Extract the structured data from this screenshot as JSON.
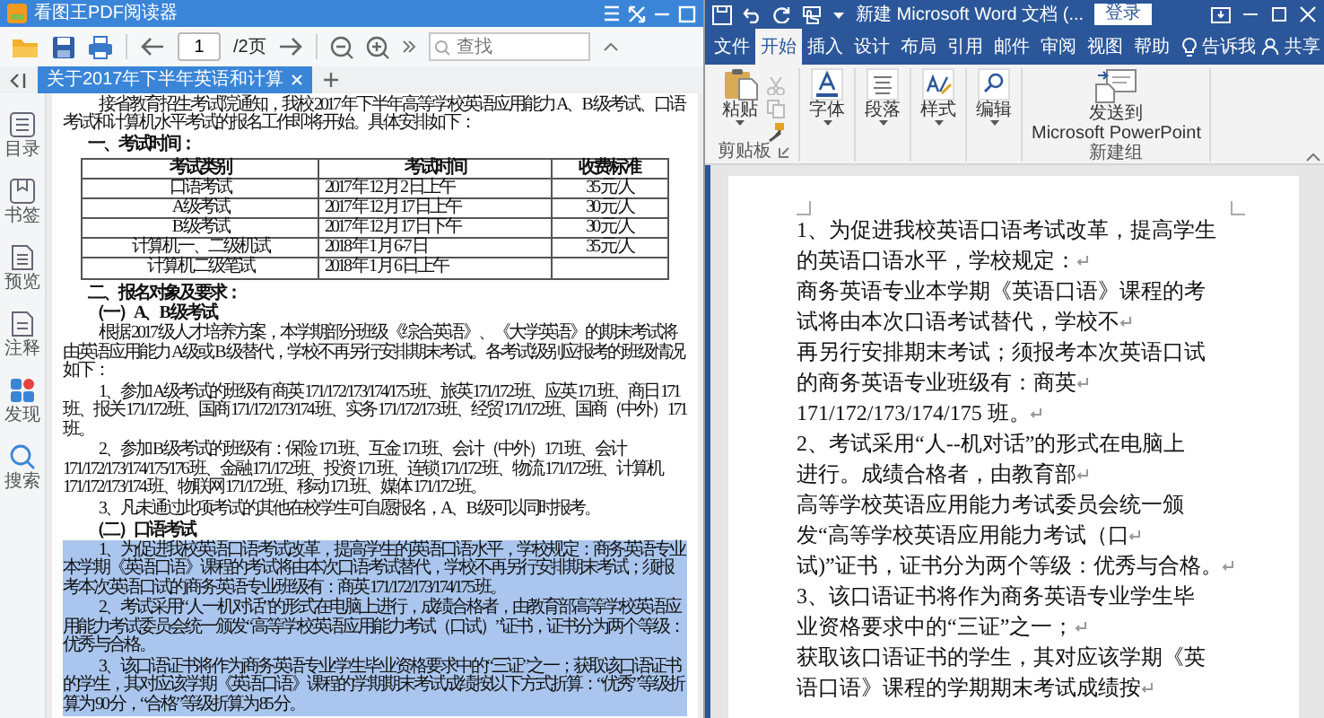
{
  "pdf_reader": {
    "window": {
      "title": "看图王PDF阅读器"
    },
    "toolbar": {
      "page_number": "1",
      "page_total": "/2页",
      "search": {
        "placeholder": "查找"
      }
    },
    "tabs": [
      {
        "label": "关于2017年下半年英语和计算",
        "selected": true
      }
    ],
    "sidebar": {
      "items": [
        {
          "label": "目录",
          "kind": "contents"
        },
        {
          "label": "书签",
          "kind": "bookmark"
        },
        {
          "label": "预览",
          "kind": "preview"
        },
        {
          "label": "注释",
          "kind": "note"
        },
        {
          "label": "发现",
          "kind": "discover"
        },
        {
          "label": "搜索",
          "kind": "search"
        }
      ]
    },
    "document": {
      "blocks": [
        {
          "kind": "paragraph",
          "text": "接省教育招生考试院通知，我校 2017 年下半年高等学校英语应用能力 A、B 级考试、口语考试和计算机水平考试的报名工作即将开始。具体安排如下：",
          "selected": false
        },
        {
          "kind": "heading",
          "text": "一、考试时间："
        },
        {
          "kind": "table",
          "columns": [
            "考试类别",
            "考试时间",
            "收费标准"
          ],
          "rows": [
            [
              "口语考试",
              "2017 年 12 月 2 日上午",
              "35 元/人"
            ],
            [
              "A 级考试",
              "2017 年 12 月 17 日上午",
              "30 元/人"
            ],
            [
              "B 级考试",
              "2017 年 12 月 17 日下午",
              "30 元/人"
            ],
            [
              "计算机一、二级机试",
              "2018 年 1 月 6-7 日",
              "35 元/人"
            ],
            [
              "计算机二级笔试",
              "2018 年 1 月 6 日上午"
            ]
          ]
        },
        {
          "kind": "heading",
          "text": "二、报名对象及要求："
        },
        {
          "kind": "heading",
          "text": "（一）A、B 级考试"
        },
        {
          "kind": "paragraph",
          "text": "根据 2017 级人才培养方案，本学期部分班级《综合英语》、《大学英语》的期末考试将由英语应用能力 A 级或 B 级替代，学校不再另行安排期末考试。各考试级别应报考的班级情况如下：",
          "selected": false
        },
        {
          "kind": "paragraph",
          "text": "1、参加 A 级考试的班级有 商英 171/172/173/174/175 班、旅英 171/172 班、应英 171 班、商日 171 班、报关 171/172/班、国商 171/172/173/174 班、实务 171/172/173 班、经贸 171/172 班、国商（中外）171 班。",
          "selected": false
        },
        {
          "kind": "paragraph",
          "text": "2、参加 B 级考试的班级有：保险 171 班、互金 171 班、会计（中外）171 班、会计 171/172/173/174/175/176 班、金融 171/172 班、投资 171 班、连锁 171/172 班、物流 171/172 班、计算机 171/172/173/174 班、物联网 171/172 班、移动 171 班、媒体 171/172 班。",
          "selected": false
        },
        {
          "kind": "paragraph",
          "text": "3、凡未通过此项考试的其他在校学生可自愿报名，A、B 级可以同时报考。",
          "selected": false
        },
        {
          "kind": "heading",
          "text": "（二）口语考试"
        },
        {
          "kind": "paragraph",
          "text": "1、为促进我校英语口语考试改革，提高学生的英语口语水平，学校规定：商务英语专业本学期《英语口语》课程的考试将由本次口语考试替代，学校不再另行安排期末考试；须报考本次英语口试的商务英语专业班级有：商英 171/172/173/174/175 班。",
          "selected": true
        },
        {
          "kind": "paragraph",
          "text": "2、考试采用“人一机对话”的形式在电脑上进行，成绩合格者，由教育部高等学校英语应用能力考试委员会统一颁发“高等学校英语应用能力考试（口试）”证书，证书分为两个等级：优秀与合格。",
          "selected": true
        },
        {
          "kind": "paragraph",
          "text": "3、该口语证书将作为商务英语专业学生毕业资格要求中的“三证”之一；获取该口语证书的学生，其对应该学期《英语口语》课程的学期期末考试成绩按以下方式折算：“优秀”等级折算为 90 分，“合格”等级折算为 85 分。",
          "selected": true
        }
      ]
    }
  },
  "word": {
    "window": {
      "title": "新建 Microsoft Word 文档 (...",
      "sign_in": "登录"
    },
    "tabs": [
      {
        "label": "文件",
        "selected": false
      },
      {
        "label": "开始",
        "selected": true
      },
      {
        "label": "插入",
        "selected": false
      },
      {
        "label": "设计",
        "selected": false
      },
      {
        "label": "布局",
        "selected": false
      },
      {
        "label": "引用",
        "selected": false
      },
      {
        "label": "邮件",
        "selected": false
      },
      {
        "label": "审阅",
        "selected": false
      },
      {
        "label": "视图",
        "selected": false
      },
      {
        "label": "帮助",
        "selected": false
      }
    ],
    "tell_me": "告诉我",
    "share": "共享",
    "ribbon": {
      "groups": [
        {
          "label": "剪贴板",
          "launcher": true,
          "buttons": [
            {
              "kind": "paste",
              "label_lines": [
                "粘贴"
              ],
              "dropdown": true
            }
          ],
          "tools": [
            {
              "kind": "cut",
              "disabled": true
            },
            {
              "kind": "copy",
              "disabled": true
            },
            {
              "kind": "format_painter",
              "disabled": false
            }
          ]
        },
        {
          "buttons": [
            {
              "kind": "font",
              "label_lines": [
                "字体"
              ],
              "dropdown": true
            }
          ]
        },
        {
          "buttons": [
            {
              "kind": "paragraph",
              "label_lines": [
                "段落"
              ],
              "dropdown": true
            }
          ]
        },
        {
          "buttons": [
            {
              "kind": "styles",
              "label_lines": [
                "样式"
              ],
              "dropdown": true
            }
          ]
        },
        {
          "buttons": [
            {
              "kind": "editing",
              "label_lines": [
                "编辑"
              ],
              "dropdown": true
            }
          ]
        },
        {
          "label": "新建组",
          "launcher": false,
          "buttons": [
            {
              "kind": "send",
              "label_lines": [
                "发送到",
                "Microsoft PowerPoint"
              ],
              "dropdown": false
            }
          ]
        }
      ]
    },
    "document": {
      "lines": [
        {
          "text": "1、为促进我校英语口语考试改革，提高学生",
          "paragraph_mark": false
        },
        {
          "text": "的英语口语水平，学校规定：",
          "paragraph_mark": true
        },
        {
          "text": "商务英语专业本学期《英语口语》课程的考",
          "paragraph_mark": false
        },
        {
          "text": "试将由本次口语考试替代，学校不",
          "paragraph_mark": true
        },
        {
          "text": "再另行安排期末考试；须报考本次英语口试",
          "paragraph_mark": false
        },
        {
          "text": "的商务英语专业班级有：商英",
          "paragraph_mark": true
        },
        {
          "text": "171/172/173/174/175 班。",
          "paragraph_mark": true
        },
        {
          "text": "2、考试采用“人--机对话”的形式在电脑上",
          "paragraph_mark": false
        },
        {
          "text": "进行。成绩合格者，由教育部",
          "paragraph_mark": true
        },
        {
          "text": "高等学校英语应用能力考试委员会统一颁",
          "paragraph_mark": false
        },
        {
          "text": "发“高等学校英语应用能力考试（口",
          "paragraph_mark": true
        },
        {
          "text": "试)”证书，证书分为两个等级：优秀与合格。",
          "paragraph_mark": true
        },
        {
          "text": "3、该口语证书将作为商务英语专业学生毕",
          "paragraph_mark": false
        },
        {
          "text": "业资格要求中的“三证”之一；",
          "paragraph_mark": true
        },
        {
          "text": "获取该口语证书的学生，其对应该学期《英",
          "paragraph_mark": false
        },
        {
          "text": "语口语》课程的学期期末考试成绩按",
          "paragraph_mark": true
        }
      ]
    }
  }
}
